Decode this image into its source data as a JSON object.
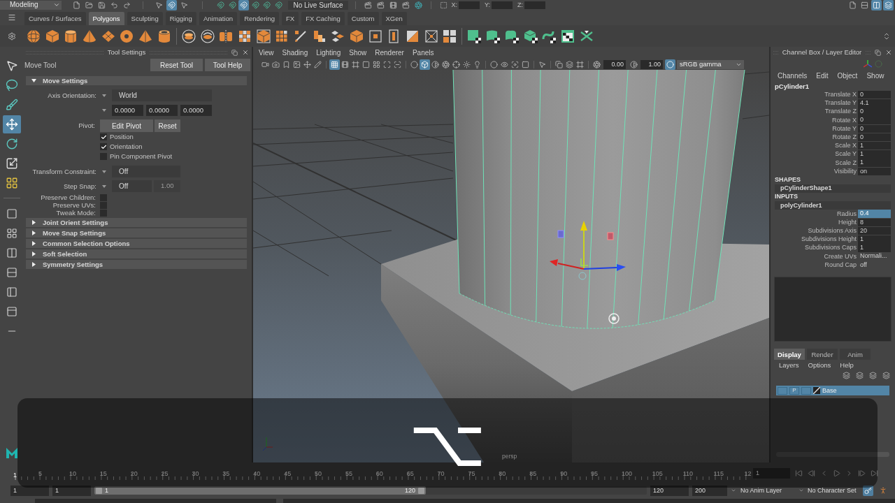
{
  "status_line": {
    "mode": "Modeling",
    "select_toggles": [
      {
        "kind": "pointer",
        "on": false
      },
      {
        "kind": "magnet",
        "on": true
      },
      {
        "kind": "pointer",
        "on": false
      }
    ],
    "snap_toggles": [
      {
        "on": false
      },
      {
        "on": false
      },
      {
        "on": true
      },
      {
        "on": false
      },
      {
        "on": false
      },
      {
        "on": false
      }
    ],
    "live_surface": "No Live Surface",
    "coordinates": [
      {
        "label": "X:"
      },
      {
        "label": "Y:"
      },
      {
        "label": "Z:"
      }
    ],
    "panel_toggles": [
      {
        "kind": "file",
        "on": false
      },
      {
        "kind": "rows",
        "on": false
      },
      {
        "kind": "columns",
        "on": true
      },
      {
        "kind": "layers",
        "on": true
      }
    ]
  },
  "shelf": {
    "tabs": [
      {
        "label": "Curves / Surfaces",
        "selected": false
      },
      {
        "label": "Polygons",
        "selected": true
      },
      {
        "label": "Sculpting",
        "selected": false
      },
      {
        "label": "Rigging",
        "selected": false
      },
      {
        "label": "Animation",
        "selected": false
      },
      {
        "label": "Rendering",
        "selected": false
      },
      {
        "label": "FX",
        "selected": false
      },
      {
        "label": "FX Caching",
        "selected": false
      },
      {
        "label": "Custom",
        "selected": false
      },
      {
        "label": "XGen",
        "selected": false
      }
    ]
  },
  "toolbox": {
    "tools": [
      {
        "kind": "pointer",
        "selected": false
      },
      {
        "kind": "lasso",
        "selected": false
      },
      {
        "kind": "brush",
        "selected": false
      },
      {
        "kind": "move",
        "selected": true
      },
      {
        "kind": "rotate",
        "selected": false
      },
      {
        "kind": "scale",
        "selected": false
      },
      {
        "kind": "four-squares",
        "selected": false
      }
    ]
  },
  "tool_settings": {
    "title": "Tool Settings",
    "tool": "Move Tool",
    "buttons": [
      "Reset Tool",
      "Tool Help"
    ],
    "sections": [
      {
        "title": "Move Settings",
        "expanded": true,
        "rows": [
          {
            "kind": "dropdown",
            "label": "Axis Orientation:",
            "value": "World"
          },
          {
            "kind": "vector",
            "values": [
              "0.0000",
              "0.0000",
              "0.0000"
            ]
          },
          {
            "kind": "buttons",
            "label": "Pivot:",
            "buttons": [
              "Edit Pivot",
              "Reset"
            ]
          },
          {
            "kind": "checkbox",
            "label": "Position",
            "checked": true
          },
          {
            "kind": "checkbox",
            "label": "Orientation",
            "checked": true
          },
          {
            "kind": "checkbox",
            "label": "Pin Component Pivot",
            "checked": false
          },
          {
            "kind": "dropdown",
            "label": "Transform Constraint:",
            "value": "Off"
          },
          {
            "kind": "step",
            "label": "Step Snap:",
            "value": "Off",
            "amount": "1.00",
            "amount_disabled": true
          },
          {
            "kind": "toggle",
            "label": "Preserve Children:",
            "checked": false
          },
          {
            "kind": "toggle",
            "label": "Preserve UVs:",
            "checked": false
          },
          {
            "kind": "toggle",
            "label": "Tweak Mode:",
            "checked": false
          }
        ]
      },
      {
        "title": "Joint Orient Settings",
        "expanded": false
      },
      {
        "title": "Move Snap Settings",
        "expanded": false
      },
      {
        "title": "Common Selection Options",
        "expanded": false
      },
      {
        "title": "Soft Selection",
        "expanded": false
      },
      {
        "title": "Symmetry Settings",
        "expanded": false
      }
    ]
  },
  "viewport": {
    "menu": [
      "View",
      "Shading",
      "Lighting",
      "Show",
      "Renderer",
      "Panels"
    ],
    "toolbar": [
      [
        {
          "kind": "video",
          "on": false
        },
        {
          "kind": "camera",
          "on": false
        },
        {
          "kind": "bookmark",
          "on": false
        },
        {
          "kind": "image",
          "on": false
        },
        {
          "kind": "move",
          "on": false
        },
        {
          "kind": "pencil",
          "on": false
        }
      ],
      [
        {
          "kind": "grid",
          "on": true
        },
        {
          "kind": "film",
          "on": false
        },
        {
          "kind": "frame",
          "on": false
        },
        {
          "kind": "square",
          "on": false
        },
        {
          "kind": "four-squares",
          "on": false
        },
        {
          "kind": "maximize",
          "on": false
        },
        {
          "kind": "scan",
          "on": false
        }
      ],
      [
        {
          "kind": "circle",
          "on": false
        },
        {
          "kind": "cube",
          "on": true
        },
        {
          "kind": "contrast",
          "on": false
        },
        {
          "kind": "aperture",
          "on": false
        },
        {
          "kind": "crosshair",
          "on": false
        },
        {
          "kind": "sun",
          "on": false
        },
        {
          "kind": "lightbulb",
          "on": false
        }
      ],
      [
        {
          "kind": "circle",
          "on": false
        },
        {
          "kind": "eye",
          "on": false
        },
        {
          "kind": "focus",
          "on": false
        },
        {
          "kind": "square",
          "on": false
        }
      ],
      [
        {
          "kind": "pointer",
          "on": false
        }
      ],
      [
        {
          "kind": "copy",
          "on": false
        },
        {
          "kind": "layers",
          "on": false
        },
        {
          "kind": "frame",
          "on": false
        }
      ]
    ],
    "exposure": "0.00",
    "gamma": "1.00",
    "color_management_on": true,
    "color_space": "sRGB gamma",
    "camera": "persp"
  },
  "channel_box": {
    "title": "Channel Box / Layer Editor",
    "menu": [
      "Channels",
      "Edit",
      "Object",
      "Show"
    ],
    "object": "pCylinder1",
    "attributes": [
      {
        "label": "Translate X",
        "value": "0",
        "boxed": true,
        "selected": false
      },
      {
        "label": "Translate Y",
        "value": "4.1",
        "boxed": true,
        "selected": false
      },
      {
        "label": "Translate Z",
        "value": "0",
        "boxed": true,
        "selected": false
      },
      {
        "label": "Rotate X",
        "value": "0",
        "boxed": true,
        "selected": false
      },
      {
        "label": "Rotate Y",
        "value": "0",
        "boxed": true,
        "selected": false
      },
      {
        "label": "Rotate Z",
        "value": "0",
        "boxed": true,
        "selected": false
      },
      {
        "label": "Scale X",
        "value": "1",
        "boxed": true,
        "selected": false
      },
      {
        "label": "Scale Y",
        "value": "1",
        "boxed": true,
        "selected": false
      },
      {
        "label": "Scale Z",
        "value": "1",
        "boxed": true,
        "selected": false
      },
      {
        "label": "Visibility",
        "value": "on",
        "boxed": true,
        "selected": false
      }
    ],
    "shapes_header": "SHAPES",
    "shape": "pCylinderShape1",
    "inputs_header": "INPUTS",
    "input": "polyCylinder1",
    "input_attributes": [
      {
        "label": "Radius",
        "value": "0.4",
        "boxed": true,
        "selected": true
      },
      {
        "label": "Height",
        "value": "8",
        "boxed": true,
        "selected": false
      },
      {
        "label": "Subdivisions Axis",
        "value": "20",
        "boxed": true,
        "selected": false
      },
      {
        "label": "Subdivisions Height",
        "value": "1",
        "boxed": true,
        "selected": false
      },
      {
        "label": "Subdivisions Caps",
        "value": "1",
        "boxed": true,
        "selected": false
      },
      {
        "label": "Create UVs",
        "value": "Normali...",
        "boxed": false,
        "selected": false
      },
      {
        "label": "Round Cap",
        "value": "off",
        "boxed": false,
        "selected": false
      }
    ]
  },
  "layer_editor": {
    "tabs": [
      {
        "label": "Display",
        "selected": true
      },
      {
        "label": "Render",
        "selected": false
      },
      {
        "label": "Anim",
        "selected": false
      }
    ],
    "menu": [
      "Layers",
      "Options",
      "Help"
    ],
    "layers": [
      {
        "name": "Base",
        "playback": "P",
        "selected": true
      }
    ]
  },
  "time_slider": {
    "current_frame_marker": "1",
    "tick_labels": [
      "5",
      "10",
      "15",
      "20",
      "25",
      "30",
      "35",
      "40",
      "45",
      "50",
      "55",
      "60",
      "65",
      "70",
      "75",
      "80",
      "85",
      "90",
      "95",
      "100",
      "105",
      "110",
      "115",
      "12"
    ],
    "current_frame": "1"
  },
  "range_slider": {
    "start": "1",
    "playback_start": "1",
    "level": 0.6,
    "range_start": "1",
    "range_end": "120",
    "playback_end": "120",
    "end": "200",
    "anim_layer": "No Anim Layer",
    "character_set": "No Character Set"
  },
  "key_overlay": {
    "key": "⌥"
  }
}
